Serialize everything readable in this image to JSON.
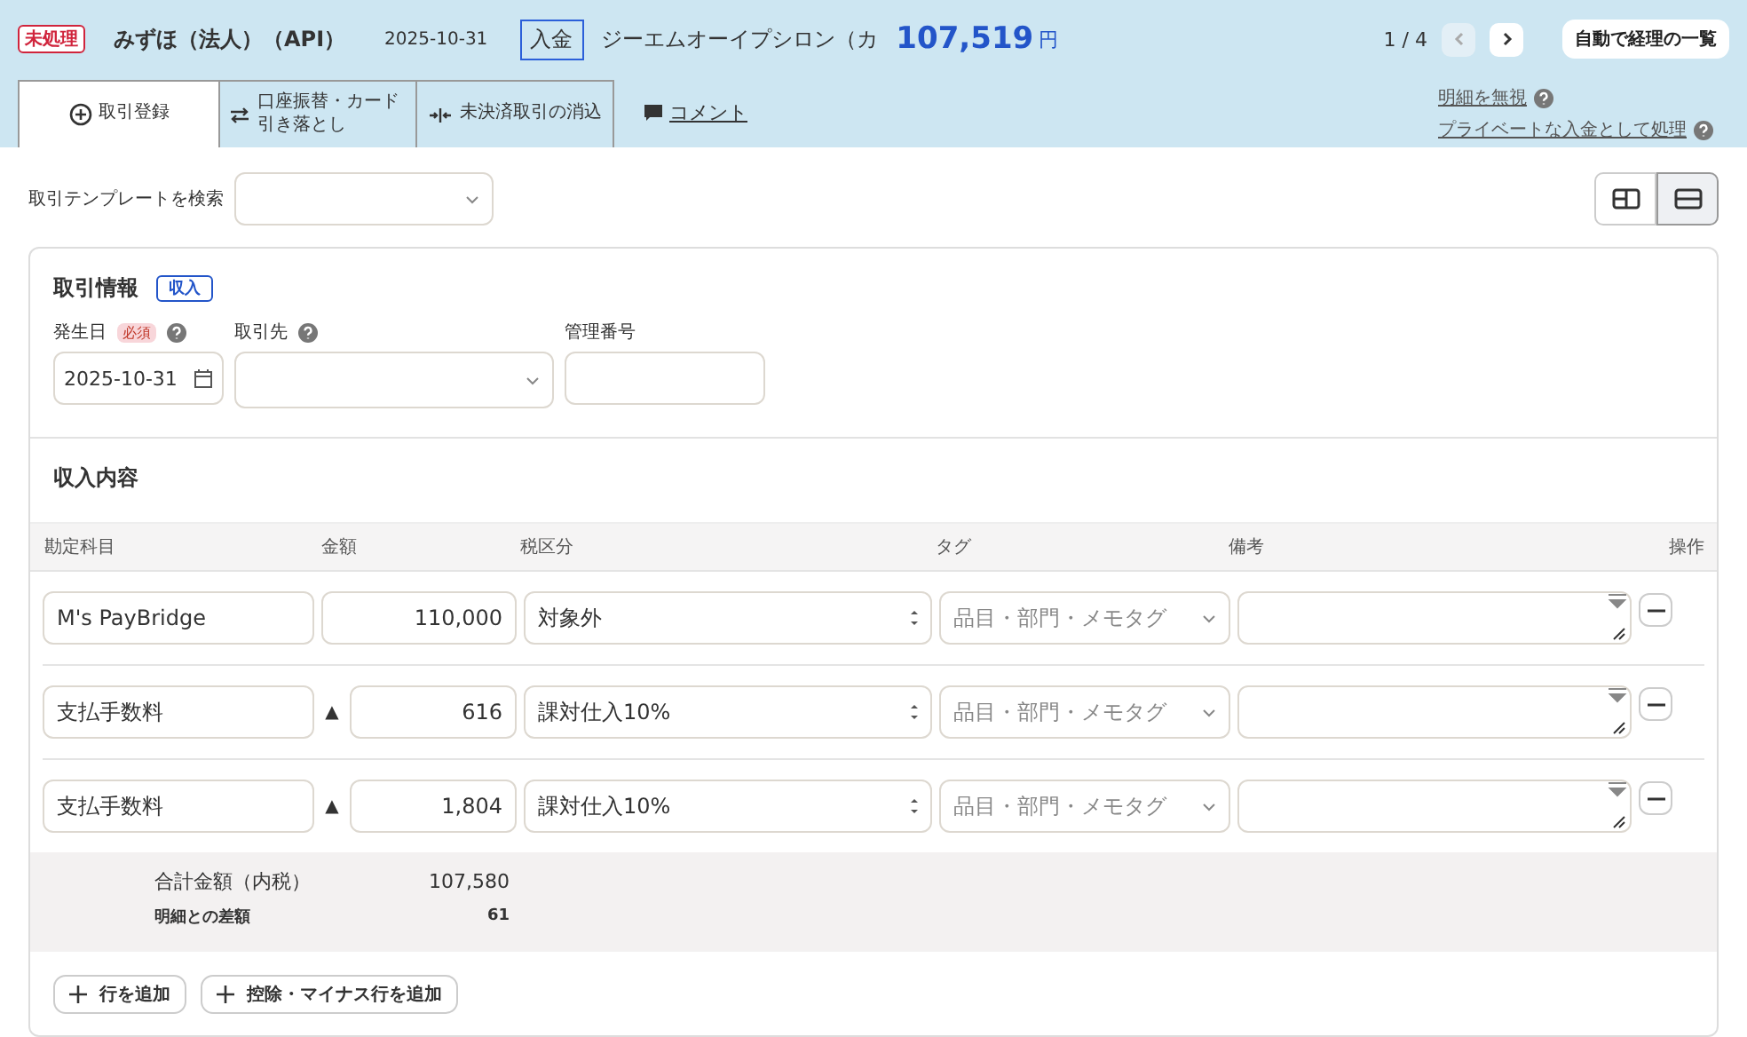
{
  "header": {
    "status": "未処理",
    "account": "みずほ（法人）（API）",
    "date": "2025-10-31",
    "direction": "入金",
    "partner": "ジーエムオーイプシロン（カ",
    "amount": "107,519",
    "currency": "円",
    "pager": "1 / 4",
    "prev_disabled": true,
    "next_disabled": false,
    "list_button": "自動で経理の一覧"
  },
  "tabs": [
    {
      "label": "取引登録",
      "kind": "plus",
      "selected": true
    },
    {
      "label": "口座振替・カード引き落とし",
      "kind": "transfer",
      "selected": false
    },
    {
      "label": "未決済取引の消込",
      "kind": "settle",
      "selected": false
    }
  ],
  "comment_link": "コメント",
  "side_links": [
    "明細を無視",
    "プライベートな入金として処理"
  ],
  "template": {
    "label": "取引テンプレートを検索"
  },
  "view_buttons": [
    {
      "kind": "split",
      "selected": false
    },
    {
      "kind": "stack",
      "selected": true
    }
  ],
  "info": {
    "title": "取引情報",
    "badge": "収入",
    "date_label": "発生日",
    "required": "必須",
    "date_value": "2025-10-31",
    "partner_label": "取引先",
    "number_label": "管理番号"
  },
  "detail": {
    "title": "収入内容",
    "columns": [
      "勘定科目",
      "金額",
      "税区分",
      "タグ",
      "備考",
      "操作"
    ],
    "rows": [
      {
        "account": "M's PayBridge",
        "amount": "110,000",
        "tax": "対象外",
        "tag_placeholder": "品目・部門・メモタグ"
      },
      {
        "account": "支払手数料",
        "mark": "▲",
        "amount": "616",
        "tax": "課対仕入10%",
        "tag_placeholder": "品目・部門・メモタグ"
      },
      {
        "account": "支払手数料",
        "mark": "▲",
        "amount": "1,804",
        "tax": "課対仕入10%",
        "tag_placeholder": "品目・部門・メモタグ"
      }
    ],
    "total_label": "合計金額（内税）",
    "total_value": "107,580",
    "diff_label": "明細との差額",
    "diff_value": "61",
    "add_buttons": [
      "行を追加",
      "控除・マイナス行を追加"
    ]
  }
}
